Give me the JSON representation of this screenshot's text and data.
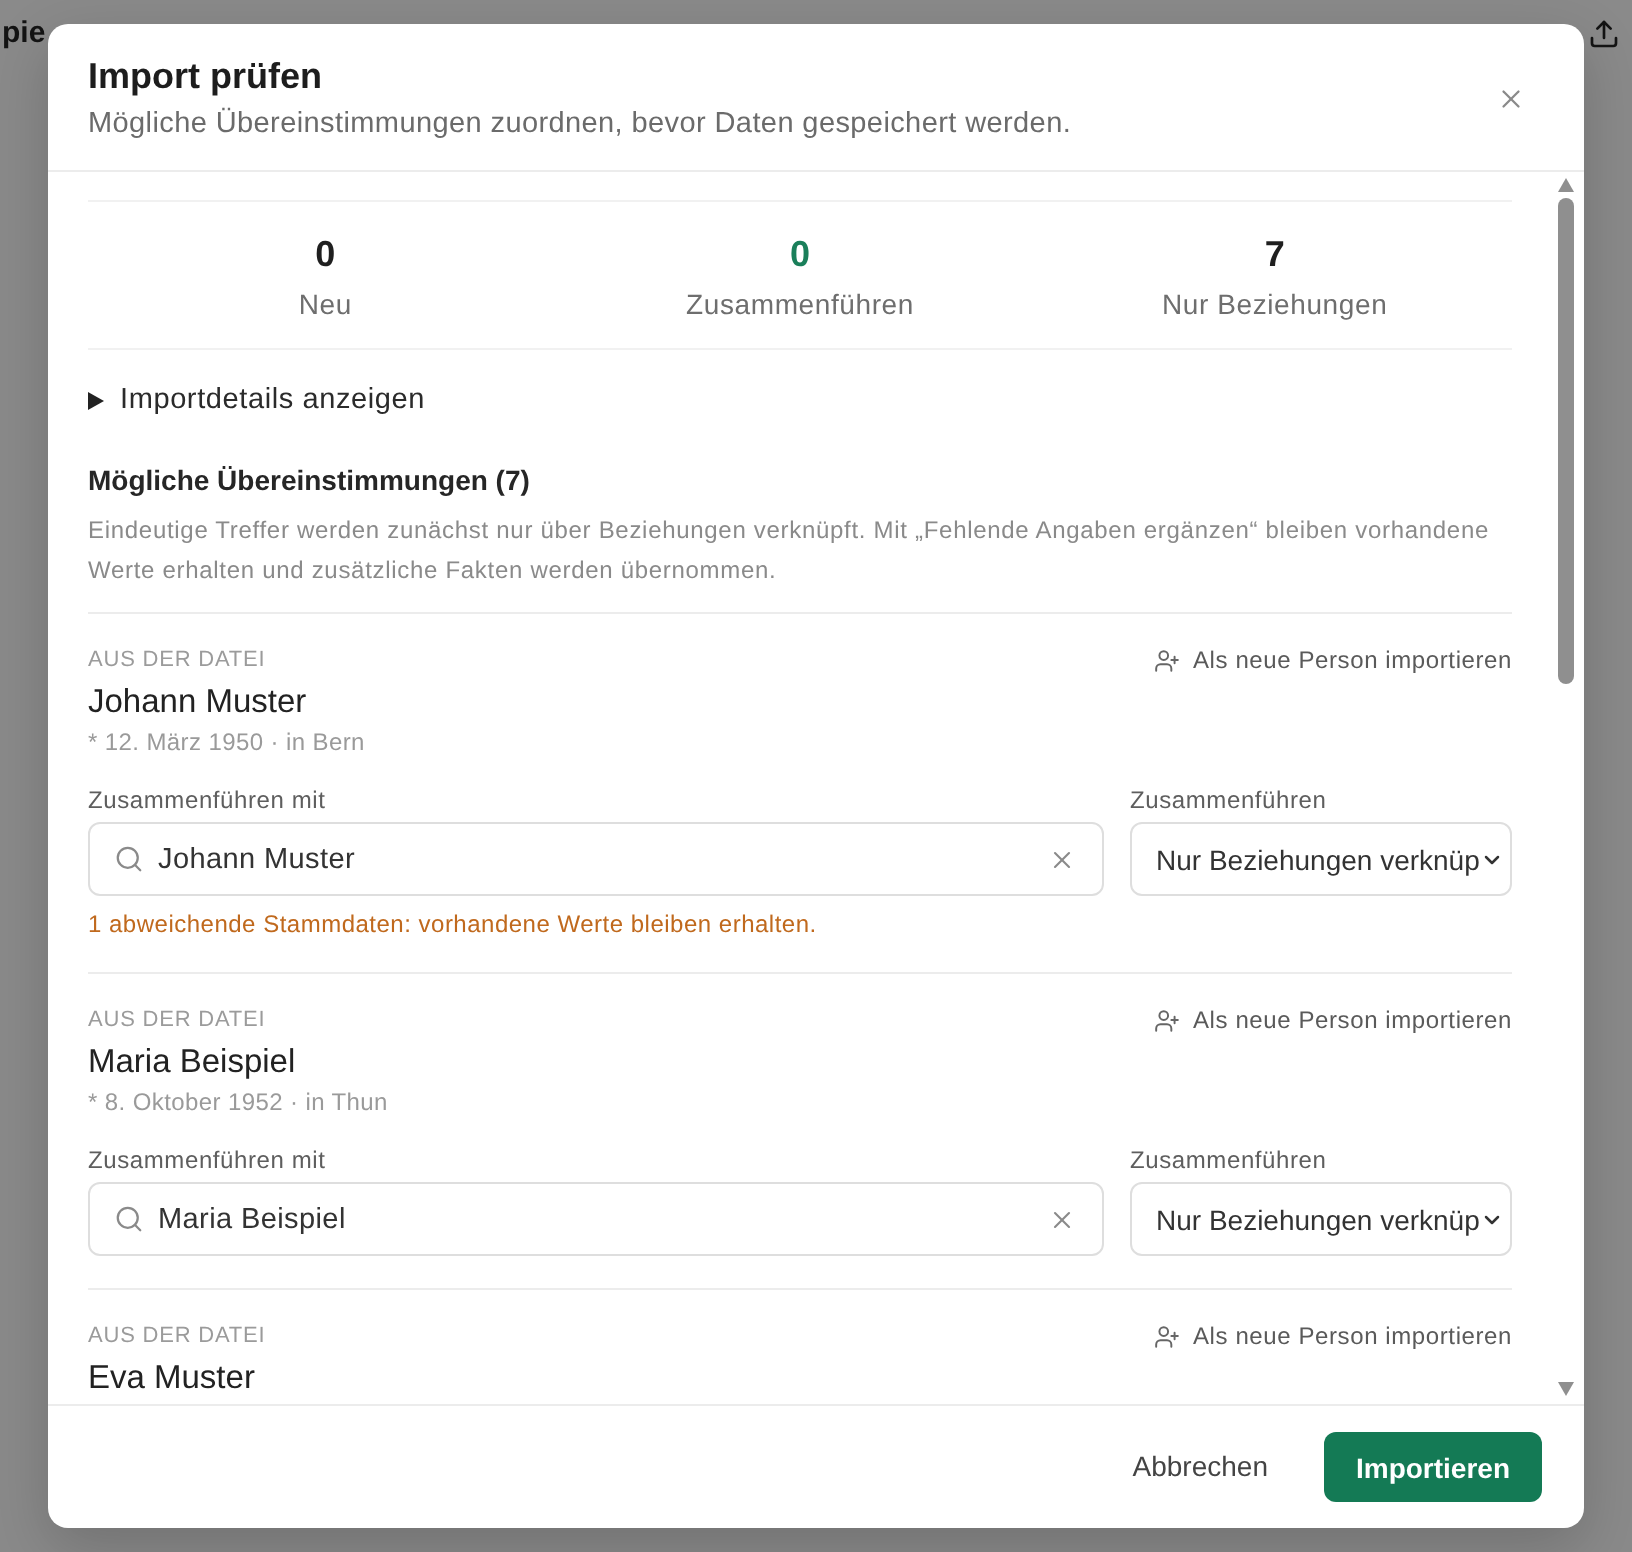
{
  "page": {
    "title": "pie"
  },
  "dialog": {
    "title": "Import prüfen",
    "subtitle": "Mögliche Übereinstimmungen zuordnen, bevor Daten gespeichert werden.",
    "stats": [
      {
        "value": "0",
        "label": "Neu",
        "color": "#1f1f1f"
      },
      {
        "value": "0",
        "label": "Zusammenführen",
        "color": "#1a7f5a"
      },
      {
        "value": "7",
        "label": "Nur Beziehungen",
        "color": "#1f1f1f"
      }
    ],
    "details_toggle": {
      "label": "Importdetails anzeigen",
      "expanded": false
    },
    "matches_title": "Mögliche Übereinstimmungen (7)",
    "matches_description": "Eindeutige Treffer werden zunächst nur über Beziehungen verknüpft. Mit „Fehlende Angaben ergänzen“ bleiben vorhandene Werte erhalten und zusätzliche Fakten werden übernommen.",
    "matches": [
      {
        "source_label": "AUS DER DATEI",
        "action": "Als neue Person importieren",
        "name": "Johann Muster",
        "meta": "* 12. März 1950 · in Bern",
        "merge_with": {
          "label": "Zusammenführen mit",
          "value": "Johann Muster"
        },
        "mode": {
          "label": "Zusammenführen",
          "value": "Nur Beziehungen verknüp"
        },
        "warning": "1 abweichende Stammdaten: vorhandene Werte bleiben erhalten."
      },
      {
        "source_label": "AUS DER DATEI",
        "action": "Als neue Person importieren",
        "name": "Maria Beispiel",
        "meta": "* 8. Oktober 1952 · in Thun",
        "merge_with": {
          "label": "Zusammenführen mit",
          "value": "Maria Beispiel"
        },
        "mode": {
          "label": "Zusammenführen",
          "value": "Nur Beziehungen verknüp"
        }
      },
      {
        "source_label": "AUS DER DATEI",
        "action": "Als neue Person importieren",
        "name": "Eva Muster"
      }
    ],
    "footer": {
      "cancel": "Abbrechen",
      "confirm": "Importieren"
    }
  }
}
